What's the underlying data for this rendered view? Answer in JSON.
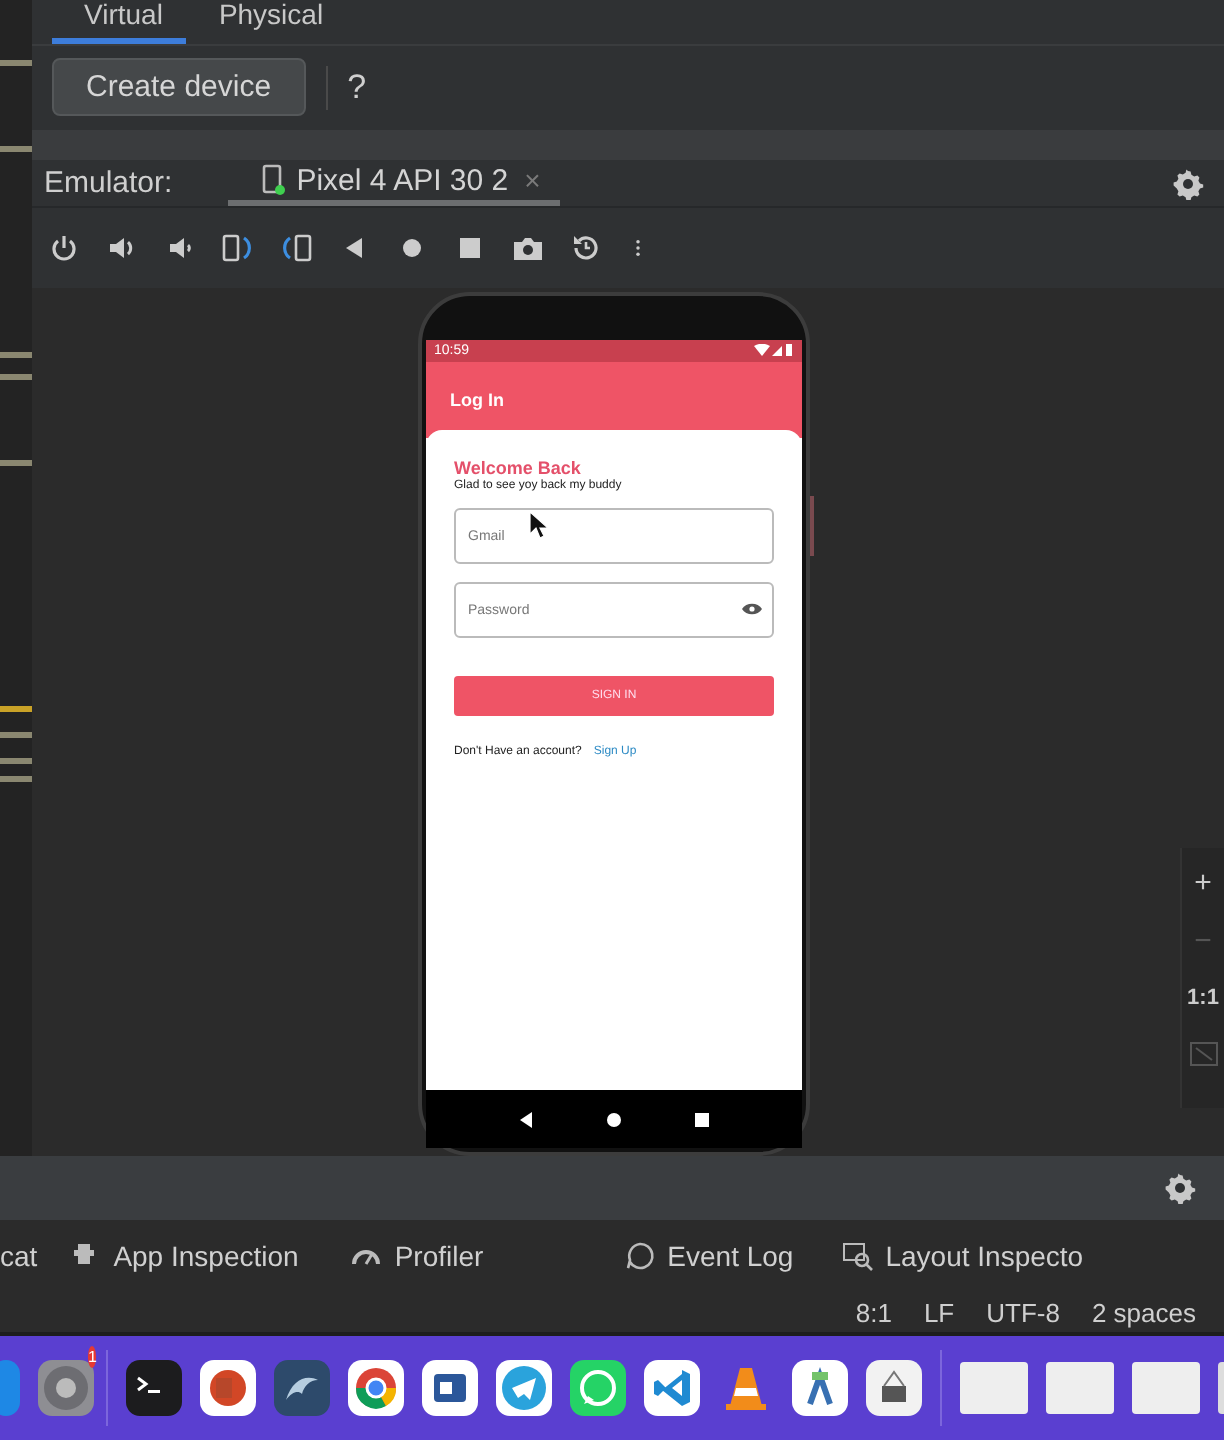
{
  "device_manager": {
    "tabs": [
      {
        "label": "Virtual",
        "selected": true
      },
      {
        "label": "Physical",
        "selected": false
      }
    ],
    "create_button": "Create device",
    "help": "?"
  },
  "emulator": {
    "label": "Emulator:",
    "device_tab": {
      "label": "Pixel 4 API 30 2",
      "close": "×",
      "running": true
    }
  },
  "phone": {
    "status_time": "10:59",
    "app_bar_title": "Log In",
    "heading": "Welcome Back",
    "subtitle": "Glad to see yoy back my buddy",
    "fields": [
      {
        "placeholder": "Gmail",
        "kind": "text"
      },
      {
        "placeholder": "Password",
        "kind": "password"
      }
    ],
    "sign_in_button": "SIGN IN",
    "prompt": "Don't Have an account?",
    "link": "Sign Up"
  },
  "zoom_controls": [
    "+",
    "−",
    "1:1"
  ],
  "tool_windows": [
    "cat",
    "App Inspection",
    "Profiler",
    "Event Log",
    "Layout Inspecto"
  ],
  "status_bar": [
    "8:1",
    "LF",
    "UTF-8",
    "2 spaces"
  ],
  "dock": {
    "badge": "1"
  }
}
